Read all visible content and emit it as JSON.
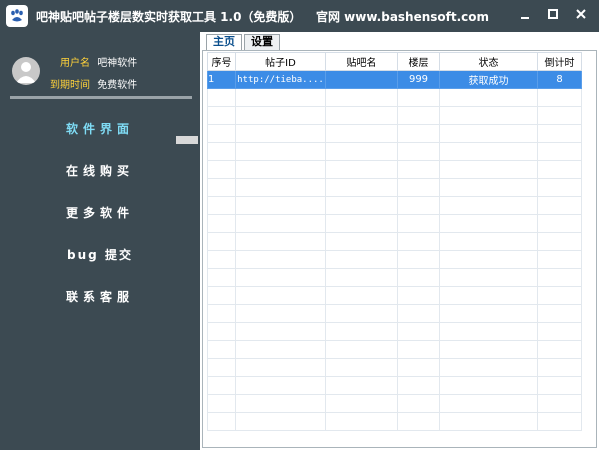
{
  "window": {
    "title": "吧神贴吧帖子楼层数实时获取工具 1.0（免费版）",
    "site": "官网 www.bashensoft.com"
  },
  "user": {
    "name_label": "用户名",
    "name_value": "吧神软件",
    "expire_label": "到期时间",
    "expire_value": "免费软件"
  },
  "nav": [
    {
      "label": "软件界面"
    },
    {
      "label": "在线购买"
    },
    {
      "label": "更多软件"
    },
    {
      "label": "bug 提交"
    },
    {
      "label": "联系客服"
    }
  ],
  "tabs": [
    {
      "label": "主页"
    },
    {
      "label": "设置"
    }
  ],
  "table": {
    "headers": [
      "序号",
      "帖子ID",
      "贴吧名",
      "楼层",
      "状态",
      "倒计时"
    ],
    "rows": [
      {
        "index": "1",
        "post_id": "http://tieba....",
        "bar_name": "",
        "floor": "999",
        "status": "获取成功",
        "countdown": "8"
      }
    ]
  },
  "icons": {
    "app": "paw-icon",
    "minimize": "minimize-icon",
    "maximize": "maximize-icon",
    "close": "close-icon",
    "avatar": "user-avatar-icon"
  },
  "colors": {
    "sidebar": "#3c4a52",
    "accent": "#7fdcf5",
    "highlight": "#3c8ce6",
    "label_yellow": "#ffd23a"
  }
}
